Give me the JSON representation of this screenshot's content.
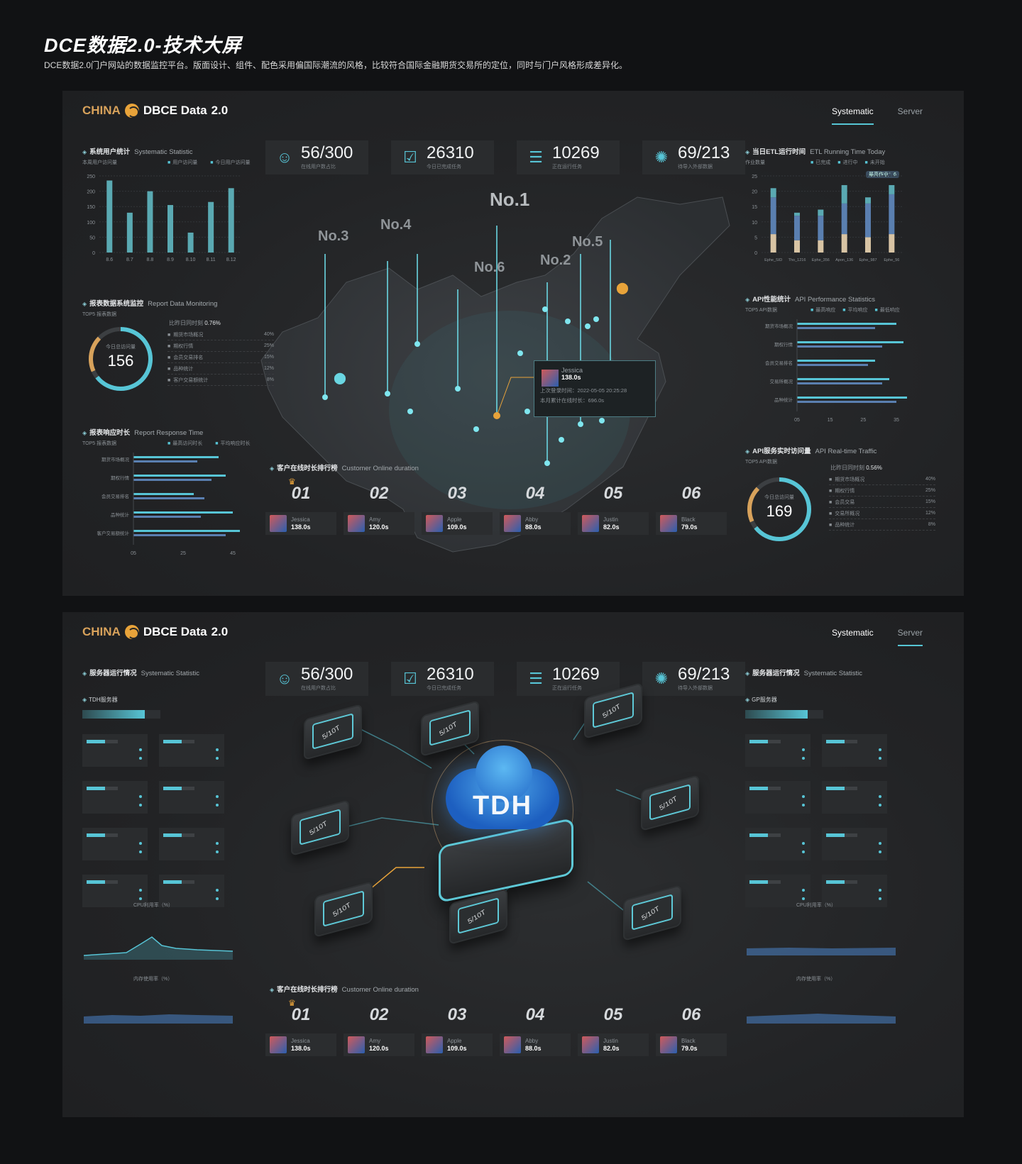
{
  "page": {
    "title": "DCE数据2.0-技术大屏",
    "subtitle": "DCE数据2.0门户网站的数据监控平台。版面设计、组件、配色采用偏国际潮流的风格，比较符合国际金融期货交易所的定位，同时与门户风格形成差异化。"
  },
  "brand": {
    "china": "CHINA",
    "name": "DBCE Data",
    "version": "2.0"
  },
  "tabs": [
    "Systematic",
    "Server"
  ],
  "kpis": [
    {
      "icon": "user-icon",
      "value": "56/300",
      "label": "在线用户数占比"
    },
    {
      "icon": "check-icon",
      "value": "26310",
      "label": "今日已完成任务"
    },
    {
      "icon": "list-icon",
      "value": "10269",
      "label": "正在运行任务"
    },
    {
      "icon": "loading-icon",
      "value": "69/213",
      "label": "待导入外部数据"
    }
  ],
  "user_stats": {
    "title": "系统用户统计",
    "en": "Systematic Statistic",
    "sub": "本周用户访问量",
    "legend": [
      "用户访问量",
      "今日用户访问量"
    ]
  },
  "report_mon": {
    "title": "报表数据系统监控",
    "en": "Report Data Monitoring",
    "sub": "TOP5 报表数据",
    "cmp_label": "比昨日同时刻",
    "cmp_val": "0.76%",
    "ring_cap": "今日总访问量",
    "ring_val": "156",
    "items": [
      {
        "name": "期货市场概况",
        "pct": "40%"
      },
      {
        "name": "期权行情",
        "pct": "25%"
      },
      {
        "name": "会员交易排名",
        "pct": "15%"
      },
      {
        "name": "品种统计",
        "pct": "12%"
      },
      {
        "name": "客户交易额统计",
        "pct": "8%"
      }
    ]
  },
  "report_resp": {
    "title": "报表响应时长",
    "en": "Report Response Time",
    "sub": "TOP5 报表数据",
    "legend": [
      "最高访问时长",
      "平均响应时长"
    ],
    "rows": [
      "期货市场概况",
      "期权行情",
      "会员交易排名",
      "品种统计",
      "客户交易额统计"
    ],
    "ticks": [
      "05",
      "25",
      "45"
    ]
  },
  "etl": {
    "title": "当日ETL运行时间",
    "en": "ETL Running Time Today",
    "sub": "作业数量",
    "tip": "最高作业：6",
    "legend": [
      "已完成",
      "进行中",
      "未开始"
    ]
  },
  "api_perf": {
    "title": "API性能统计",
    "en": "API Performance Statistics",
    "sub": "TOP5 API数据",
    "legend": [
      "最高响应",
      "平均响应",
      "最低响应"
    ],
    "rows": [
      "期货市场概况",
      "期权行情",
      "会员交易排名",
      "交易所概况",
      "品种统计"
    ],
    "ticks": [
      "05",
      "15",
      "25",
      "35"
    ]
  },
  "api_traffic": {
    "title": "API服务实时访问量",
    "en": "API Real-time Traffic",
    "sub": "TOP5 API数据",
    "cmp_label": "比昨日同时刻",
    "cmp_val": "0.56%",
    "ring_cap": "今日总访问量",
    "ring_val": "169",
    "items": [
      {
        "name": "期货市场概况",
        "pct": "40%"
      },
      {
        "name": "期权行情",
        "pct": "25%"
      },
      {
        "name": "会员交易",
        "pct": "15%"
      },
      {
        "name": "交易所概况",
        "pct": "12%"
      },
      {
        "name": "品种统计",
        "pct": "8%"
      }
    ]
  },
  "map": {
    "markers": [
      "No.1",
      "No.2",
      "No.3",
      "No.4",
      "No.5",
      "No.6"
    ],
    "popup": {
      "name": "Jessica",
      "time": "138.0s",
      "line1": "上次登录时间：2022-05-05 20:25:28",
      "line2": "本月累计在线时长：696.0s"
    }
  },
  "ranking": {
    "title": "客户在线时长排行榜",
    "en": "Customer Online duration",
    "items": [
      {
        "no": "01",
        "name": "Jessica",
        "time": "138.0s"
      },
      {
        "no": "02",
        "name": "Amy",
        "time": "120.0s"
      },
      {
        "no": "03",
        "name": "Apple",
        "time": "109.0s"
      },
      {
        "no": "04",
        "name": "Abby",
        "time": "88.0s"
      },
      {
        "no": "05",
        "name": "Justin",
        "time": "82.0s"
      },
      {
        "no": "06",
        "name": "Black",
        "time": "79.0s"
      }
    ]
  },
  "server_left": {
    "title": "服务器运行情况",
    "en": "Systematic Statistic",
    "group": "TDH服务器",
    "cpu_title": "CPU利用率（%）",
    "mem_title": "内存使用率（%）"
  },
  "server_right": {
    "title": "服务器运行情况",
    "en": "Systematic Statistic",
    "group": "GP服务器",
    "cpu_title": "CPU利用率（%）",
    "mem_title": "内存使用率（%）"
  },
  "tdh": {
    "label": "TDH",
    "node_label": "5/10T"
  },
  "chart_data": [
    {
      "type": "bar",
      "title": "系统用户统计",
      "categories": [
        "8.6",
        "8.7",
        "8.8",
        "8.9",
        "8.10",
        "8.11",
        "8.12"
      ],
      "values": [
        235,
        130,
        200,
        155,
        65,
        165,
        210
      ],
      "ylim": [
        0,
        250
      ],
      "yticks": [
        0,
        50,
        100,
        150,
        200,
        250
      ]
    },
    {
      "type": "bar",
      "title": "当日ETL运行时间",
      "categories": [
        "Ephe_SID",
        "Tho_1216",
        "Ephe_356",
        "Apon_136",
        "Ephe_987",
        "Ephe_56"
      ],
      "series": [
        {
          "name": "已完成",
          "values": [
            6,
            4,
            4,
            6,
            5,
            6
          ]
        },
        {
          "name": "进行中",
          "values": [
            12,
            8,
            8,
            10,
            11,
            13
          ]
        },
        {
          "name": "未开始",
          "values": [
            3,
            1,
            2,
            6,
            2,
            3
          ]
        }
      ],
      "ylim": [
        0,
        25
      ],
      "yticks": [
        0,
        5,
        10,
        15,
        20,
        25
      ]
    }
  ]
}
